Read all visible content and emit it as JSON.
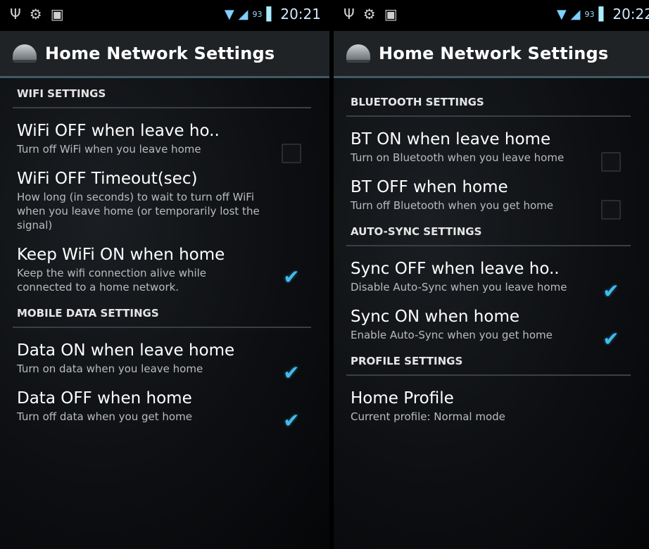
{
  "left": {
    "status": {
      "battery_pct": "93",
      "time": "20:21"
    },
    "app_title": "Home Network Settings",
    "sections": [
      {
        "header": "WIFI SETTINGS",
        "items": [
          {
            "title": "WiFi OFF when leave ho..",
            "summary": "Turn off WiFi when you leave home",
            "checkbox": "unchecked"
          },
          {
            "title": "WiFi OFF Timeout(sec)",
            "summary": "How long (in seconds) to wait to turn off WiFi when you leave home (or temporarily lost the signal)",
            "checkbox": "none"
          },
          {
            "title": "Keep WiFi ON when home",
            "summary": "Keep the wifi connection alive while connected to a home network.",
            "checkbox": "checked"
          }
        ]
      },
      {
        "header": "MOBILE DATA SETTINGS",
        "items": [
          {
            "title": "Data ON when leave home",
            "summary": "Turn on data when you leave home",
            "checkbox": "checked"
          },
          {
            "title": "Data OFF when home",
            "summary": "Turn off data when you get home",
            "checkbox": "checked"
          }
        ]
      }
    ]
  },
  "right": {
    "status": {
      "battery_pct": "93",
      "time": "20:22"
    },
    "app_title": "Home Network Settings",
    "sections": [
      {
        "header": "BLUETOOTH SETTINGS",
        "items": [
          {
            "title": "BT ON when leave home",
            "summary": "Turn on Bluetooth when you leave home",
            "checkbox": "unchecked"
          },
          {
            "title": "BT OFF when home",
            "summary": "Turn off Bluetooth when you get home",
            "checkbox": "unchecked"
          }
        ]
      },
      {
        "header": "AUTO-SYNC SETTINGS",
        "items": [
          {
            "title": "Sync OFF when leave ho..",
            "summary": "Disable Auto-Sync when you leave home",
            "checkbox": "checked"
          },
          {
            "title": "Sync ON when home",
            "summary": "Enable Auto-Sync when you get home",
            "checkbox": "checked"
          }
        ]
      },
      {
        "header": "PROFILE SETTINGS",
        "items": [
          {
            "title": "Home Profile",
            "summary": "Current profile: Normal mode",
            "checkbox": "none"
          }
        ]
      }
    ]
  },
  "colors": {
    "accent": "#45b9ea",
    "actionbar": "#202326",
    "divider": "#3b3f43"
  },
  "icons": {
    "usb": "usb-icon",
    "app": "app-icon",
    "gallery": "gallery-icon",
    "wifi": "wifi-icon",
    "signal": "signal-icon",
    "battery": "battery-icon",
    "check": "check-icon"
  }
}
